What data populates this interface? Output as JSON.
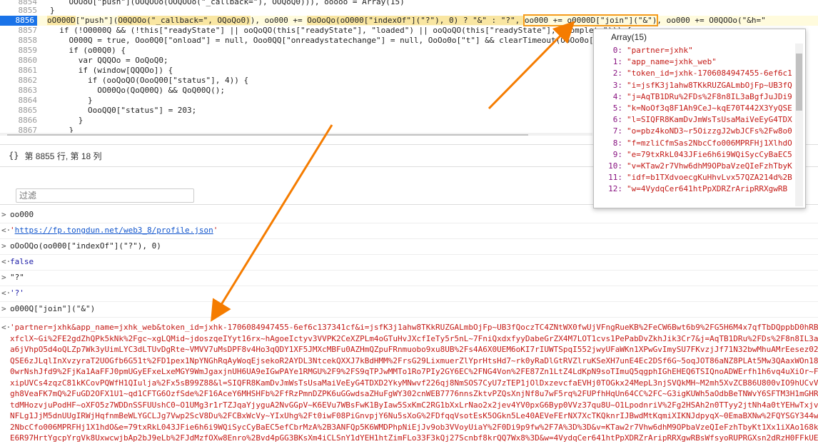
{
  "editor": {
    "lines": [
      {
        "num": "8854",
        "code": "    OOOoO[\"push\"](OOQOOo(OOQOOo(\"_callback=\"), OOQoQ0))), ooooo = Array(15)"
      },
      {
        "num": "8855",
        "code": "}"
      },
      {
        "num": "8856",
        "code_parts": [
          "oO000D",
          "[\"push\"]",
          "(",
          "O0QOOo(\"_callback=\", OQoQo0)",
          "), oo000 ",
          "+= ",
          "OoOoQo(oO000[\"indexOf\"](\"?\"), 0) ? \"&\" : \"?\", ",
          "oo000 += o0000D[\"join\"](\"&\")",
          ", oo000 ",
          "+= ",
          "O0QOOo(\"&h=\""
        ]
      },
      {
        "num": "8857",
        "code": "  if (!O0000Q && (!this[\"readyState\"] || ooQoQO(this[\"readyState\"], \"loaded\") || ooQoQO(this[\"readyState\"], \"complete\"))) {"
      },
      {
        "num": "8858",
        "code": "    O000Q = true, Ooo0Q0[\"onload\"] = null, Ooo0QQ[\"onreadystatechange\"] = null, OoOo0o[\"t\"] && clearTimeout(OoOo0o[\"t\"]);"
      },
      {
        "num": "8859",
        "code": "    if (o00Q0) {"
      },
      {
        "num": "8860",
        "code": "      var QQQOo = OoQoQ0;"
      },
      {
        "num": "8861",
        "code": "      if (window[QQQOo]) {"
      },
      {
        "num": "8862",
        "code": "        if (ooQoQO(OooQ00[\"status\"], 4)) {"
      },
      {
        "num": "8863",
        "code": "          OO00Qo(QoQ00Q) && QoQ00Q();"
      },
      {
        "num": "8864",
        "code": "        }"
      },
      {
        "num": "8865",
        "code": "        OooQQ0[\"status\"] = 203;"
      },
      {
        "num": "8866",
        "code": "      }"
      },
      {
        "num": "8867",
        "code": "    }"
      }
    ]
  },
  "status": {
    "braces": "{}",
    "position": "第 8855 行, 第 18 列"
  },
  "filter": {
    "placeholder": "过滤"
  },
  "console": {
    "entries": [
      {
        "kind": "in",
        "text": "oo000"
      },
      {
        "kind": "out",
        "text": "'https://fp.tongdun.net/web3_8/profile.json'",
        "is_link": true
      },
      {
        "kind": "in",
        "text": "oOoOQo(oo000[\"indexOf\"](\"?\"), 0)"
      },
      {
        "kind": "out",
        "text": "false"
      },
      {
        "kind": "in",
        "text": "\"?\""
      },
      {
        "kind": "out",
        "text": "'?'"
      },
      {
        "kind": "in",
        "text": "o000Q[\"join\"](\"&\")"
      }
    ],
    "result_lines": [
      "'partner=jxhk&app_name=jxhk_web&token_id=jxhk-1706084947455-6ef6c137341cf&i=jsfK3j1ahw8TKkRUZGALmbOjFp~UB3fQoczTC4ZNtWX0fwUjVFngRueKB%2FeCW6Bwt6b9%2FG5H6M4x7qfTbDQppbD0hRB",
      "xfclX~Gi%2FE2gdZhQPk5kNk%2Fgc~xgLQMid~jdoszqeIYyt16rx~hAgoeIctyv3VVPK2CeXZPLm4oGTuHvJXcfIeTy5r5nL~7FniQxdxfyyDabeGrZX4M7LOT1cvs1PePabDvZkhJik3Cr7&j=AqTB1DRu%2FDs%2F8n8IL3aBf",
      "a6jVhpO5d4oQLZp7Wk3yUimLYC3dLTUvDgRte~VMVV7uMsDPF8v4Ho3qQDY1XF5JMXcMBFu0AZHmQZpuFRnmuobo9xu8UB%2Fs4A6X0UEM6oKI7rIUWTSpqI552jwyUFaWKn1XPwGvImySU7FKvzjJf71N32bwMhuAMrEesez02",
      "QSE6zJLqlInXvzyraT2UOGfb6G51t%2FD1pex1NpYNGhRqAyWoqEjsekoR2AYDL3NtcekQXXJ7kBdHMM%2FrsG29LixmuerZlYprHtsHd7~rk0yRaDlGtRVZlruKSeXH7unE4Ec2DSf6G~5oqJOT86aNZ8PLAt5Mw3QAaxWOn18y",
      "0wrNshJfd9%2FjKa1AaFFJ0pmUGyEFxeLxeMGY9WmJgaxjnUH6UA9eIGwPAYe1RMGU%2F9%2FS9qTPJwMMTo1Ro7PIy2GY6EC%2FNG4Von%2FE87Zn1LtZ4LdKpN9soTImuQ5qgphIGhEHEQ6TSIQnoADWErfh1h6vq4uXiOr~FzRC",
      "xipUVCs4zqzC81kKCovPQWfH1QIulja%2Fx5sB99Z88&l=SIQFR8KamDvJmWsTsUsaMaiVeEyG4TDXD2YkyMNwvf226qj8NmSOS7CyU7zTEP1jOlDxzevcfaEVHj0TOGkx24MepL3njSVQkMH~M2mh5XvZCB86U800vIO9hUCvVp",
      "gh8VeaFK7mQ%2FuGD2OFX1U1~qd1CFTG6OzfSde%2F16AceY6MHSHFb%2FfRzPmnDZPK6uGGwdsaZHuFgWY302cnWEB7776nnsZktvPZQsXnjNf8u7wF5rq%2FUPfhHqUn64CC%2FC~G3igKUWh5aOdbBeTNWvY6SFTM3H1mGHRd",
      "tdMHozvjuPodHF~oXFO5z7WDDnSSFUUshC0~O1UMg3r1rTZJqaYjyguA2NvGGpV~K6EVu7WBsFwK1ByIaw5SxKmC2RG1bXxLrNao2x2jev4YV0pxG6Byp0VVz37qu8U~O1LpodnriV%2Fg2HSAh2n0TTyy2jtNh4a0tYEHwTxjvk",
      "NFLg1JjM5dnUUgIRWjHqfnmBeWLYGCLJg7Vwp2ScV8Du%2FCBxWcVy~YIxUhg%2Ft0iwF08PiGnvpjY6Nu5sXoG%2FDfqqVsotEsK5OGkn5Le40AEVeFErNX7XcTKQknrIJBwdMtKqmiXIKNJdpyqX~0EmaBXNw%2FQYSGY344wF",
      "2NbcCfo006MPRFHj1X1hdO&e=79txRkL043JFie6h6i9WQiSycCyBaEC5efCbrMzA%2B3ANFQp5K6WMDPhpNiEjJv9ob3VVoyUiaY%2F0Di9p9fw%2F7A%3D%3D&v=KTaw2r7Vhw6dhM9OPbaVzeQIeFzhTbyKt1Xx1iXAo168kf",
      "E6R97HrtYgcpYrgVk8UxwcwjbAp2bJ9eLb%2FJdMzfOXw8Enro%2Bvd4pGG3BKsXm4iCLSnY1dYEH1htZimFLo33F3kQj27Scnbf8krQQ7Wx8%3D&w=4VydqCer641htPpXDRZrAripRRXgwRBsWfsyoRUPRGXsn2dRzH0FFkUEu"
    ]
  },
  "popup": {
    "title": "Array(15)",
    "items": [
      {
        "idx": "0:",
        "val": "\"partner=jxhk\""
      },
      {
        "idx": "1:",
        "val": "\"app_name=jxhk_web\""
      },
      {
        "idx": "2:",
        "val": "\"token_id=jxhk-1706084947455-6ef6c1"
      },
      {
        "idx": "3:",
        "val": "\"i=jsfK3j1ahw8TKkRUZGALmbOjFp~UB3fQ"
      },
      {
        "idx": "4:",
        "val": "\"j=AqTB1DRu%2FDs%2F8n8IL3aBgfJuJDi9"
      },
      {
        "idx": "5:",
        "val": "\"k=NoOf3q8F1Ah9CeJ~kqE70T442X3YyQSE"
      },
      {
        "idx": "6:",
        "val": "\"l=SIQFR8KamDvJmWsTsUsaMaiVeEyG4TDX"
      },
      {
        "idx": "7:",
        "val": "\"o=pbz4koND3~r5OizzgJ2wbJCFs%2Fw8o0"
      },
      {
        "idx": "8:",
        "val": "\"f=mzliCfmSas2NbcCfo006MPRFHj1XlhdO"
      },
      {
        "idx": "9:",
        "val": "\"e=79txRkL043JFie6h6i9WQiSycCyBaEC5"
      },
      {
        "idx": "10:",
        "val": "\"v=KTaw2r7Vhw6dhM9OPbaVzeQIeFzhTbyK"
      },
      {
        "idx": "11:",
        "val": "\"idf=b1TXdvoecgKuHhvLvx57QZA214d%2B"
      },
      {
        "idx": "12:",
        "val": "\"w=4VydqCer641htPpXDRZrAripRRXgwRB"
      }
    ]
  },
  "colors": {
    "accent": "#1a73e8",
    "annotation": "#f57c00",
    "string": "#c41a16"
  }
}
